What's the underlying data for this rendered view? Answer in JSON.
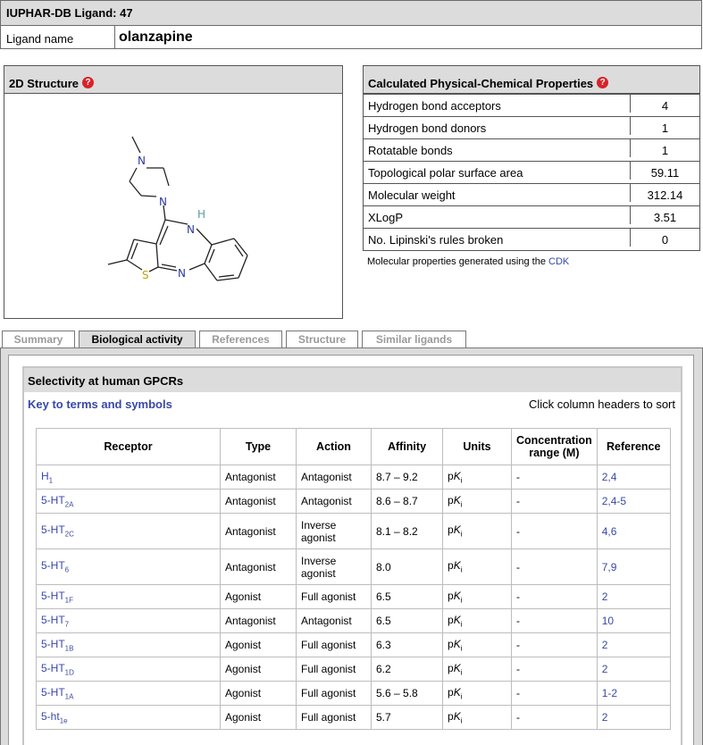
{
  "header": {
    "title": "IUPHAR-DB Ligand: 47",
    "name_label": "Ligand name",
    "name_value": "olanzapine"
  },
  "structure": {
    "title": "2D Structure",
    "help": "?",
    "atoms": {
      "n1": "N",
      "n2": "N",
      "n3": "N",
      "h": "H",
      "n4": "N",
      "s": "S"
    }
  },
  "properties": {
    "title": "Calculated Physical-Chemical Properties",
    "help": "?",
    "rows": [
      {
        "label": "Hydrogen bond acceptors",
        "value": "4"
      },
      {
        "label": "Hydrogen bond donors",
        "value": "1"
      },
      {
        "label": "Rotatable bonds",
        "value": "1"
      },
      {
        "label": "Topological polar surface area",
        "value": "59.11"
      },
      {
        "label": "Molecular weight",
        "value": "312.14"
      },
      {
        "label": "XLogP",
        "value": "3.51"
      },
      {
        "label": "No. Lipinski's rules broken",
        "value": "0"
      }
    ],
    "note_prefix": "Molecular properties generated using the",
    "note_link": "CDK"
  },
  "tabs": [
    "Summary",
    "Biological activity",
    "References",
    "Structure",
    "Similar ligands"
  ],
  "selectivity": {
    "title": "Selectivity at human GPCRs",
    "key_link": "Key to terms and symbols",
    "sort_hint": "Click column headers to sort",
    "columns": [
      "Receptor",
      "Type",
      "Action",
      "Affinity",
      "Units",
      "Concentration range (M)",
      "Reference"
    ],
    "rows": [
      {
        "rec": "H",
        "sub": "1",
        "type": "Antagonist",
        "action": "Antagonist",
        "affinity": "8.7 – 9.2",
        "u1": "p",
        "u2": "K",
        "u3": "i",
        "conc": "-",
        "ref": "2,4"
      },
      {
        "rec": "5-HT",
        "sub": "2A",
        "type": "Antagonist",
        "action": "Antagonist",
        "affinity": "8.6 – 8.7",
        "u1": "p",
        "u2": "K",
        "u3": "i",
        "conc": "-",
        "ref": "2,4-5"
      },
      {
        "rec": "5-HT",
        "sub": "2C",
        "type": "Antagonist",
        "action": "Inverse agonist",
        "affinity": "8.1 – 8.2",
        "u1": "p",
        "u2": "K",
        "u3": "i",
        "conc": "-",
        "ref": "4,6"
      },
      {
        "rec": "5-HT",
        "sub": "6",
        "type": "Antagonist",
        "action": "Inverse agonist",
        "affinity": "8.0",
        "u1": "p",
        "u2": "K",
        "u3": "i",
        "conc": "-",
        "ref": "7,9"
      },
      {
        "rec": "5-HT",
        "sub": "1F",
        "type": "Agonist",
        "action": "Full agonist",
        "affinity": "6.5",
        "u1": "p",
        "u2": "K",
        "u3": "i",
        "conc": "-",
        "ref": "2"
      },
      {
        "rec": "5-HT",
        "sub": "7",
        "type": "Antagonist",
        "action": "Antagonist",
        "affinity": "6.5",
        "u1": "p",
        "u2": "K",
        "u3": "i",
        "conc": "-",
        "ref": "10"
      },
      {
        "rec": "5-HT",
        "sub": "1B",
        "type": "Agonist",
        "action": "Full agonist",
        "affinity": "6.3",
        "u1": "p",
        "u2": "K",
        "u3": "i",
        "conc": "-",
        "ref": "2"
      },
      {
        "rec": "5-HT",
        "sub": "1D",
        "type": "Agonist",
        "action": "Full agonist",
        "affinity": "6.2",
        "u1": "p",
        "u2": "K",
        "u3": "i",
        "conc": "-",
        "ref": "2"
      },
      {
        "rec": "5-HT",
        "sub": "1A",
        "type": "Agonist",
        "action": "Full agonist",
        "affinity": "5.6 – 5.8",
        "u1": "p",
        "u2": "K",
        "u3": "i",
        "conc": "-",
        "ref": "1-2"
      },
      {
        "rec": "5-ht",
        "sub": "1e",
        "type": "Agonist",
        "action": "Full agonist",
        "affinity": "5.7",
        "u1": "p",
        "u2": "K",
        "u3": "i",
        "conc": "-",
        "ref": "2"
      }
    ]
  }
}
